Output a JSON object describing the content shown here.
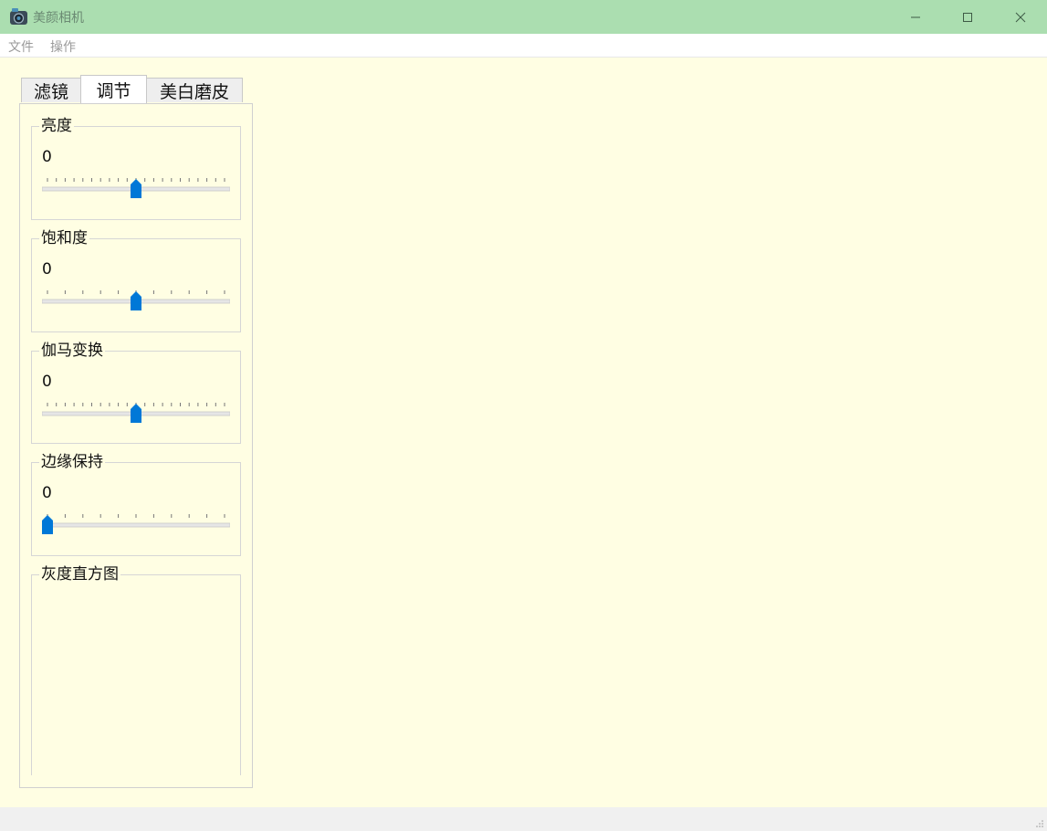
{
  "window": {
    "title": "美颜相机",
    "app_icon": "camera-app-icon",
    "controls": [
      "minimize-icon",
      "maximize-icon",
      "close-icon"
    ]
  },
  "menu": [
    {
      "label": "文件"
    },
    {
      "label": "操作"
    }
  ],
  "tabs": [
    {
      "label": "滤镜",
      "active": false
    },
    {
      "label": "调节",
      "active": true
    },
    {
      "label": "美白磨皮",
      "active": false
    }
  ],
  "adjust": {
    "brightness": {
      "label": "亮度",
      "value": "0",
      "level": 0.5
    },
    "saturation": {
      "label": "饱和度",
      "value": "0",
      "level": 0.5
    },
    "gamma": {
      "label": "伽马变换",
      "value": "0",
      "level": 0.5
    },
    "edge": {
      "label": "边缘保持",
      "value": "0",
      "level": 0.0
    },
    "histogram": {
      "label": "灰度直方图"
    }
  },
  "colors": {
    "titlebar": "#abdeb0",
    "background": "#fffee3",
    "slider_handle": "#0078d7"
  }
}
